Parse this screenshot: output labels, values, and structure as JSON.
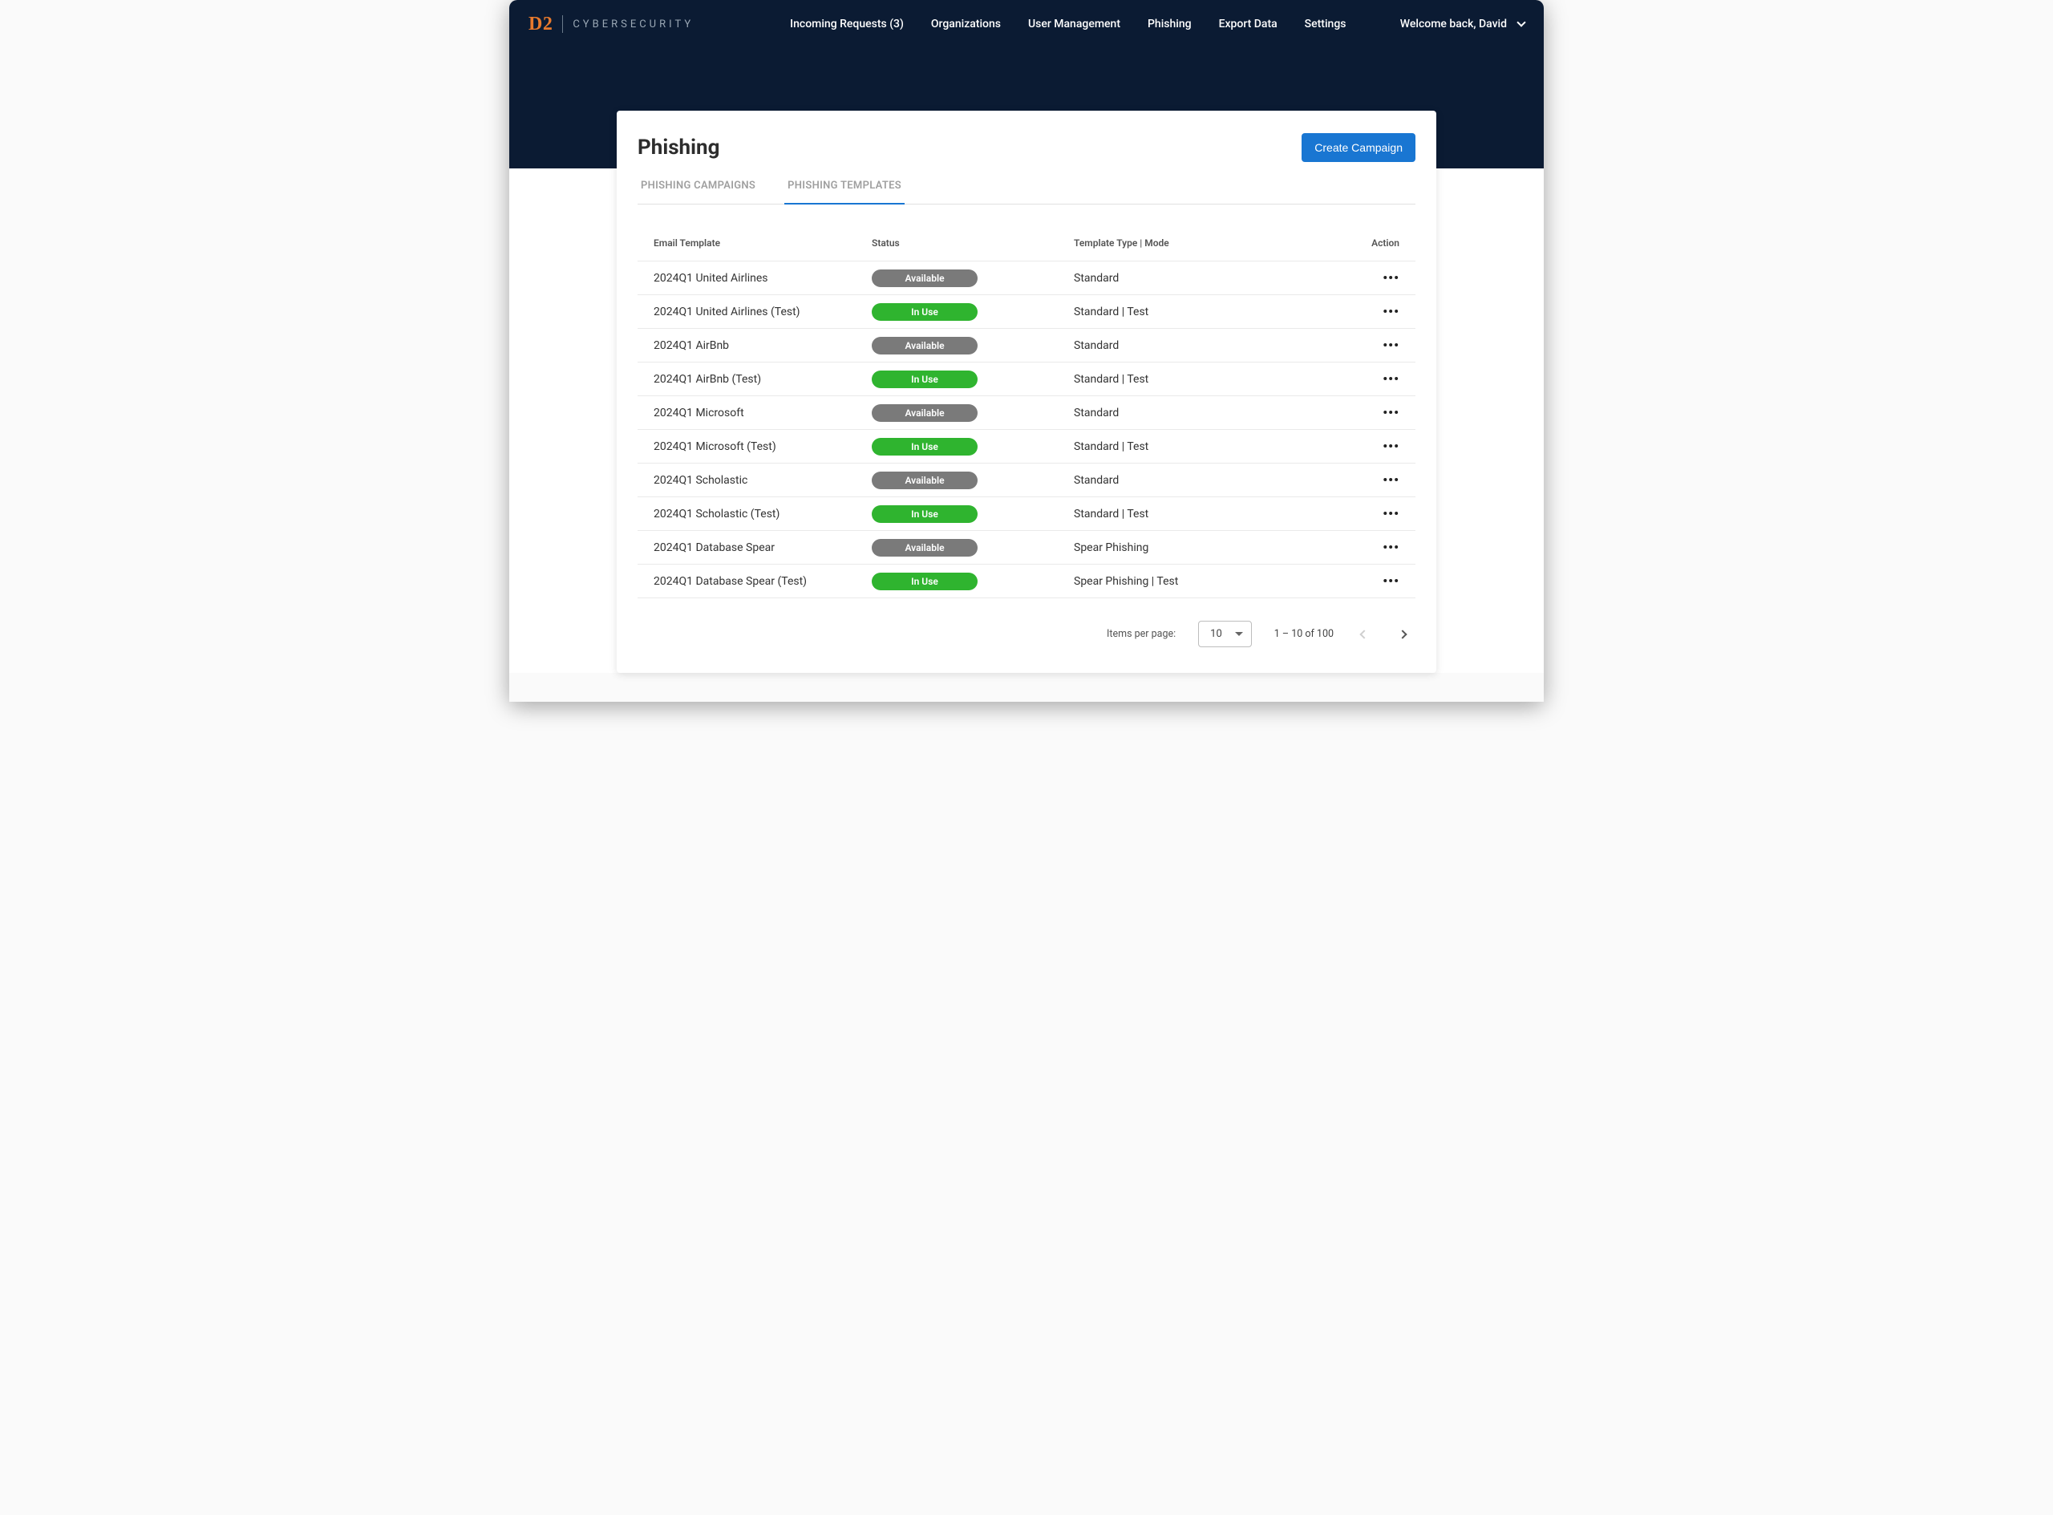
{
  "brand": {
    "d2": "D2",
    "cyber": "CYBERSECURITY"
  },
  "nav": {
    "items": [
      "Incoming Requests (3)",
      "Organizations",
      "User Management",
      "Phishing",
      "Export Data",
      "Settings"
    ],
    "welcome": "Welcome back, David"
  },
  "page": {
    "title": "Phishing",
    "create_button": "Create Campaign",
    "tabs": [
      {
        "label": "PHISHING CAMPAIGNS",
        "active": false
      },
      {
        "label": "PHISHING TEMPLATES",
        "active": true
      }
    ]
  },
  "table": {
    "headers": {
      "template": "Email Template",
      "status": "Status",
      "type": "Template Type | Mode",
      "action": "Action"
    },
    "status_labels": {
      "available": "Available",
      "inuse": "In Use"
    },
    "rows": [
      {
        "template": "2024Q1 United Airlines",
        "status": "available",
        "type": "Standard"
      },
      {
        "template": "2024Q1 United Airlines (Test)",
        "status": "inuse",
        "type": "Standard | Test"
      },
      {
        "template": "2024Q1 AirBnb",
        "status": "available",
        "type": "Standard"
      },
      {
        "template": "2024Q1 AirBnb (Test)",
        "status": "inuse",
        "type": "Standard | Test"
      },
      {
        "template": "2024Q1 Microsoft",
        "status": "available",
        "type": "Standard"
      },
      {
        "template": "2024Q1 Microsoft (Test)",
        "status": "inuse",
        "type": "Standard | Test"
      },
      {
        "template": "2024Q1 Scholastic",
        "status": "available",
        "type": "Standard"
      },
      {
        "template": "2024Q1 Scholastic (Test)",
        "status": "inuse",
        "type": "Standard | Test"
      },
      {
        "template": "2024Q1 Database Spear",
        "status": "available",
        "type": "Spear Phishing"
      },
      {
        "template": "2024Q1 Database Spear (Test)",
        "status": "inuse",
        "type": "Spear Phishing | Test"
      }
    ]
  },
  "paginator": {
    "label": "Items per page:",
    "page_size": "10",
    "range": "1 – 10 of 100"
  }
}
